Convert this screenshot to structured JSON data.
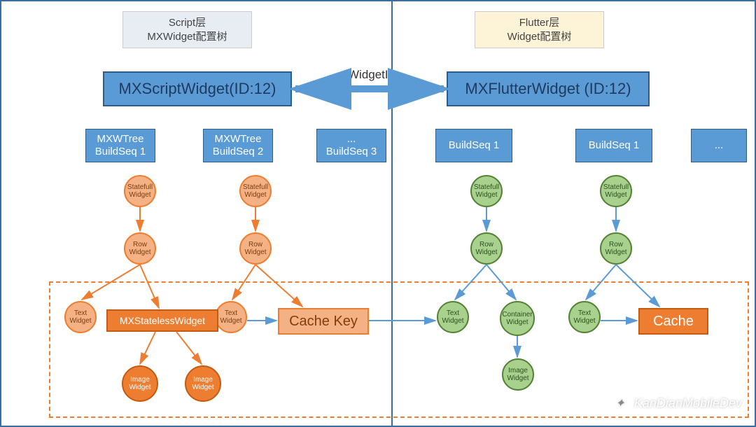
{
  "headers": {
    "left_line1": "Script层",
    "left_line2": "MXWidget配置树",
    "right_line1": "Flutter层",
    "right_line2": "Widget配置树"
  },
  "top": {
    "mxscript": "MXScriptWidget(ID:12)",
    "mxflutter": "MXFlutterWidget (ID:12)",
    "widgetid_label": "WidgetID"
  },
  "left_seqs": {
    "seq1_line1": "MXWTree",
    "seq1_line2": "BuildSeq 1",
    "seq2_line1": "MXWTree",
    "seq2_line2": "BuildSeq 2",
    "seq3_line1": "...",
    "seq3_line2": "BuildSeq 3"
  },
  "right_seqs": {
    "seq1": "BuildSeq 1",
    "seq2": "BuildSeq 1",
    "seq3": "..."
  },
  "nodes": {
    "statefull": "Statefull\nWidget",
    "row": "Row\nWidget",
    "text": "Text\nWidget",
    "container": "Container\nWidget",
    "image": "Image\nWidget"
  },
  "boxes": {
    "mxstateless": "MXStatelessWidget",
    "cachekey": "Cache Key",
    "cache": "Cache"
  },
  "watermark": "KanDianMobileDev",
  "colors": {
    "blue": "#5b9bd5",
    "blue_border": "#2e5d8a",
    "orange_light": "#f4b183",
    "orange_dark": "#ed7d31",
    "green": "#a9d18e"
  }
}
